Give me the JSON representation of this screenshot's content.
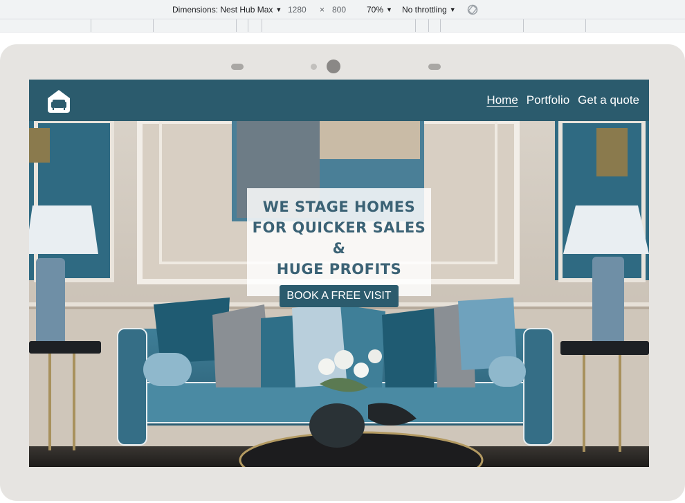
{
  "devtools": {
    "device_label": "Dimensions: Nest Hub Max",
    "width": "1280",
    "times": "×",
    "height": "800",
    "zoom": "70%",
    "throttling": "No throttling",
    "caret": "▼"
  },
  "site": {
    "nav": [
      {
        "label": "Home",
        "active": true
      },
      {
        "label": "Portfolio",
        "active": false
      },
      {
        "label": "Get a quote",
        "active": false
      }
    ],
    "hero": {
      "title_lines": [
        "WE STAGE HOMES",
        "FOR QUICKER SALES &",
        "HUGE PROFITS"
      ],
      "cta": "BOOK A FREE VISIT"
    }
  },
  "colors": {
    "brand": "#2b5b6d",
    "hero_text": "#3b6275",
    "frame": "#e6e4e1"
  },
  "icons": {
    "logo": "house-sofa-icon",
    "rotate": "rotate-icon"
  }
}
